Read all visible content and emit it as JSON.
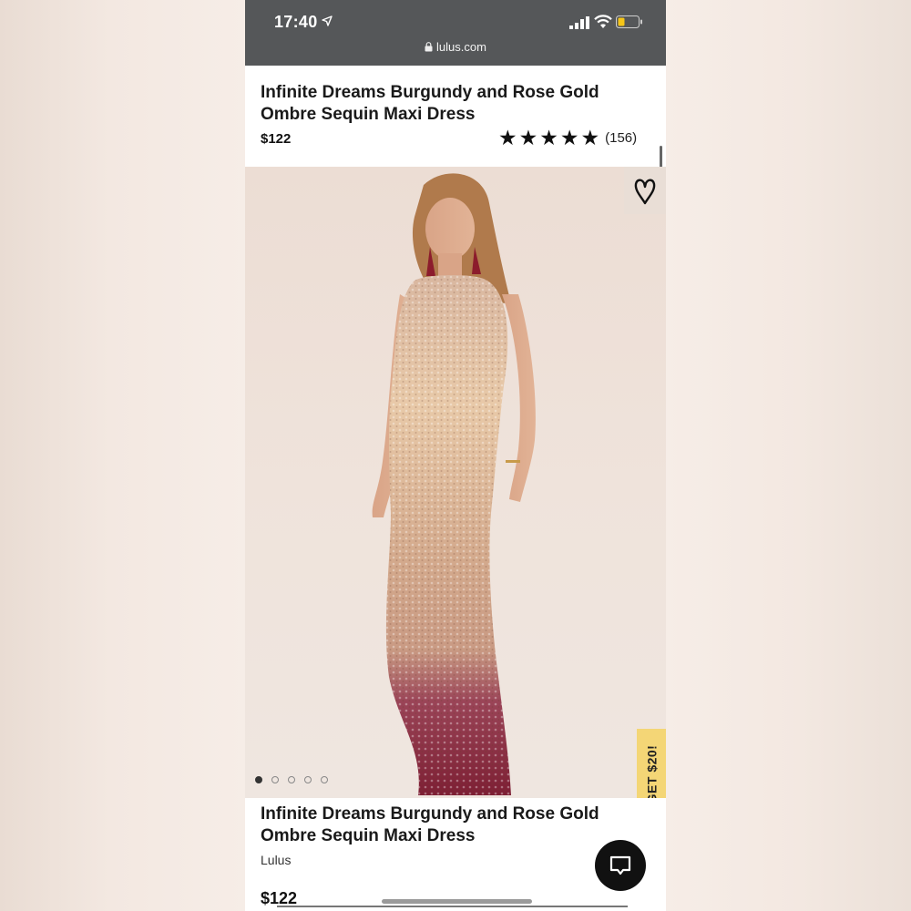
{
  "status_bar": {
    "time": "17:40",
    "url": "lulus.com",
    "battery_color": "#f5c518"
  },
  "header": {
    "title": "Infinite Dreams Burgundy and Rose Gold Ombre Sequin Maxi Dress",
    "price": "$122",
    "rating_stars": 5,
    "review_count": "(156)"
  },
  "image": {
    "carousel_count": 5,
    "carousel_active": 1,
    "dress_colors": [
      "#e8c9a8",
      "#c99a83",
      "#7d1f34"
    ]
  },
  "promo": {
    "label": "GET $20!",
    "color": "#f4d676"
  },
  "product": {
    "title": "Infinite Dreams Burgundy and Rose Gold Ombre Sequin Maxi Dress",
    "brand": "Lulus",
    "price": "$122"
  },
  "icons": {
    "location": "location-arrow-icon",
    "signal": "signal-icon",
    "wifi": "wifi-icon",
    "battery": "battery-icon",
    "lock": "lock-icon",
    "favorite": "heart-icon",
    "chat": "chat-icon"
  }
}
